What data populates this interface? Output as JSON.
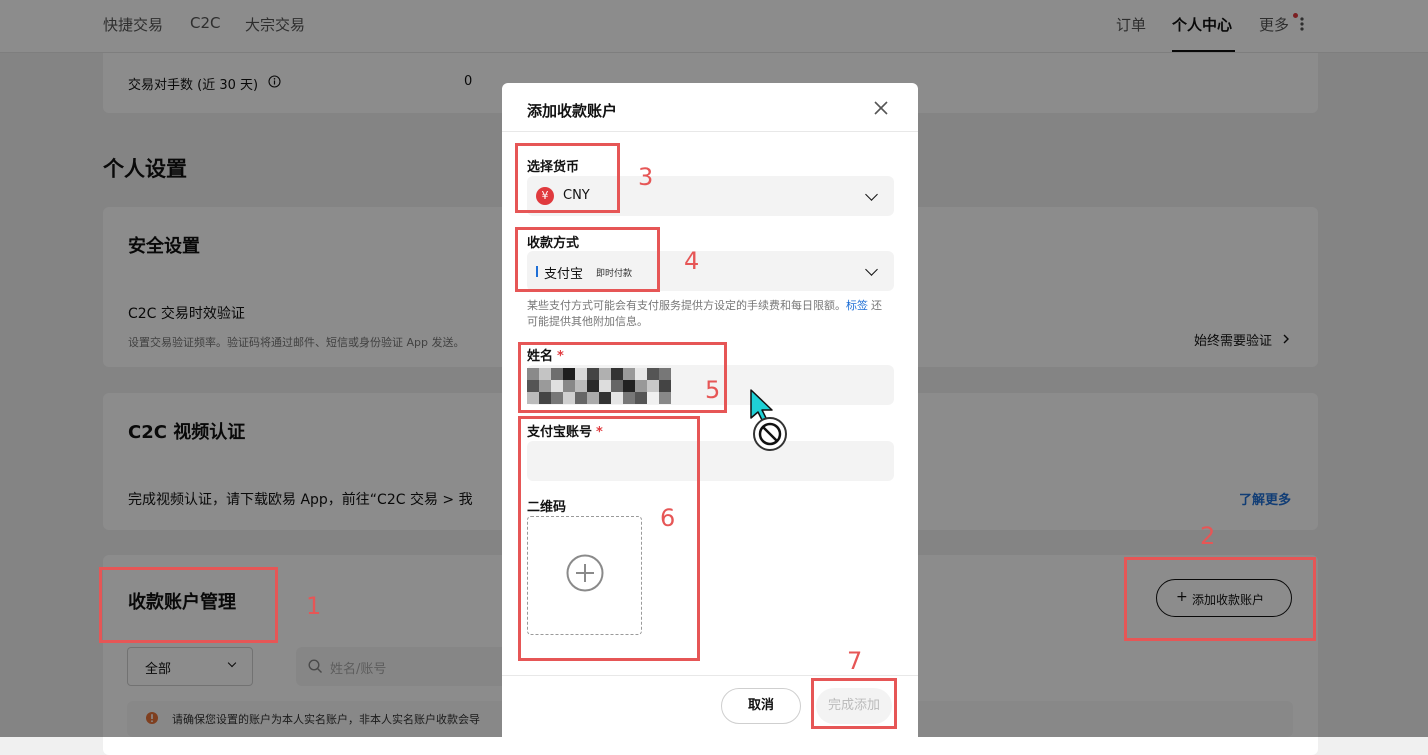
{
  "nav": {
    "left": [
      "快捷交易",
      "C2C",
      "大宗交易"
    ],
    "right": [
      "订单",
      "个人中心",
      "更多"
    ]
  },
  "stats": {
    "label": "交易对手数 (近 30 天)",
    "value": "0"
  },
  "personal_settings": {
    "title": "个人设置"
  },
  "security": {
    "title": "安全设置",
    "item_title": "C2C 交易时效验证",
    "item_desc": "设置交易验证频率。验证码将通过邮件、短信或身份验证 App 发送。",
    "item_action": "始终需要验证"
  },
  "video": {
    "title": "C2C 视频认证",
    "desc": "完成视频认证，请下载欧易 App，前往“C2C 交易 > 我",
    "link": "了解更多"
  },
  "accounts": {
    "title": "收款账户管理",
    "add_button": "添加收款账户",
    "filter_value": "全部",
    "search_placeholder": "姓名/账号",
    "notice": "请确保您设置的账户为本人实名账户，非本人实名账户收款会导"
  },
  "modal": {
    "title": "添加收款账户",
    "currency_label": "选择货币",
    "currency_value": "CNY",
    "currency_symbol": "¥",
    "method_label": "收款方式",
    "method_value": "支付宝",
    "method_tag": "即时付款",
    "hint_part1": "某些支付方式可能会有支付服务提供方设定的手续费和每日限额。",
    "hint_link": "标签",
    "hint_part2": "还可能提供其他附加信息。",
    "name_label": "姓名",
    "account_label": "支付宝账号",
    "qr_label": "二维码",
    "required_mark": "*",
    "cancel": "取消",
    "submit": "完成添加"
  },
  "annotations": [
    "1",
    "2",
    "3",
    "4",
    "5",
    "6",
    "7"
  ],
  "colors": {
    "accent": "#1f6fd6",
    "annotation": "#e65656",
    "currency_badge": "#e03a3e"
  },
  "icons": [
    "info-icon",
    "close-icon",
    "chevron-down-icon",
    "plus-icon",
    "search-icon",
    "warning-icon",
    "cursor-icon",
    "not-allowed-icon",
    "more-icon",
    "chevron-right-icon"
  ]
}
